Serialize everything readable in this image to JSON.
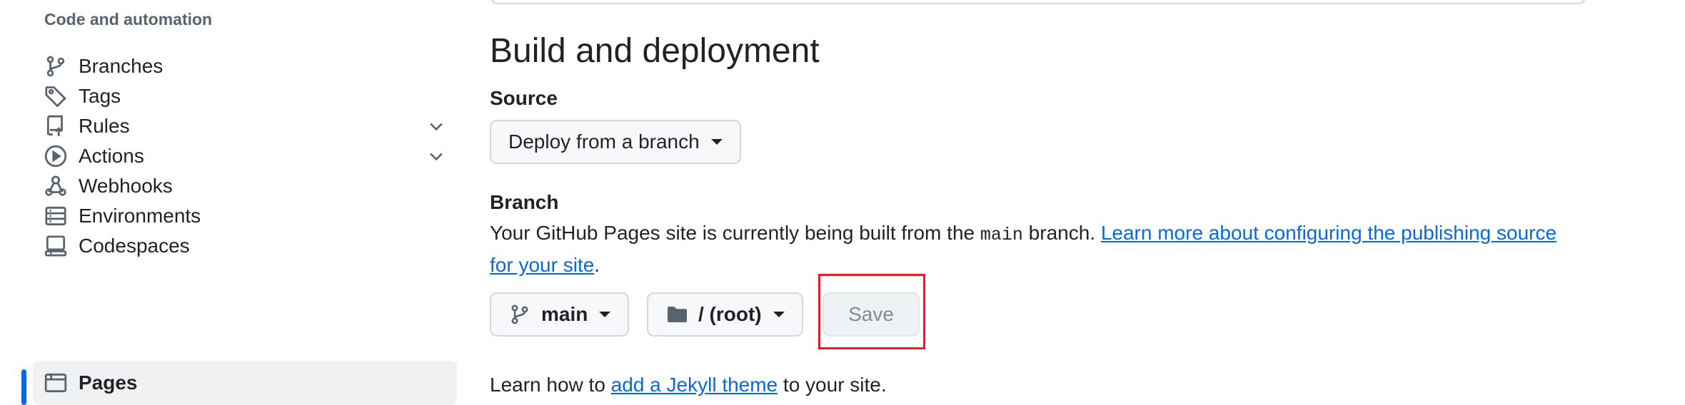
{
  "sidebar": {
    "section_title": "Code and automation",
    "items": [
      {
        "label": "Branches",
        "icon": "git-branch-icon"
      },
      {
        "label": "Tags",
        "icon": "tag-icon"
      },
      {
        "label": "Rules",
        "icon": "repo-push-icon",
        "has_chevron": true
      },
      {
        "label": "Actions",
        "icon": "play-icon",
        "has_chevron": true
      },
      {
        "label": "Webhooks",
        "icon": "webhook-icon"
      },
      {
        "label": "Environments",
        "icon": "server-icon"
      },
      {
        "label": "Codespaces",
        "icon": "codespaces-icon"
      },
      {
        "label": "Pages",
        "icon": "browser-icon",
        "active": true
      }
    ]
  },
  "main": {
    "heading": "Build and deployment",
    "source": {
      "label": "Source",
      "selected": "Deploy from a branch"
    },
    "branch": {
      "label": "Branch",
      "desc_prefix": "Your GitHub Pages site is currently being built from the ",
      "desc_code": "main",
      "desc_mid": " branch. ",
      "desc_link": "Learn more about configuring the publishing source for your site",
      "desc_suffix": ".",
      "branch_select": "main",
      "folder_select": "/ (root)",
      "save_label": "Save"
    },
    "footer": {
      "prefix": "Learn how to ",
      "link": "add a Jekyll theme",
      "suffix": " to your site."
    }
  },
  "colors": {
    "accent": "#0969da",
    "highlight": "#e11d2a",
    "active_bg": "#eff1f3"
  }
}
